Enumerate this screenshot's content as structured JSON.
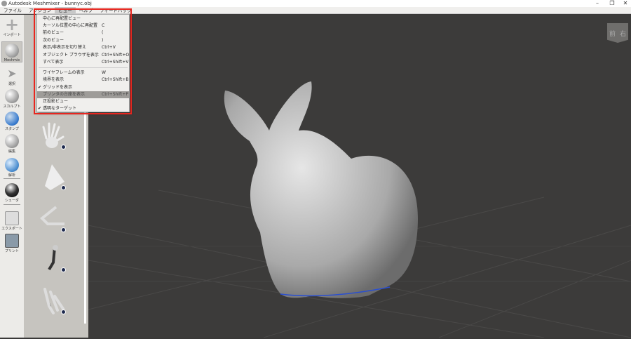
{
  "window": {
    "title": "Autodesk Meshmixer - bunnyc.obj",
    "minimize": "–",
    "restore": "❐",
    "close": "✕"
  },
  "menubar": [
    "ファイル",
    "アクション",
    "ビュー",
    "ヘルプ",
    "フィードバック"
  ],
  "view_menu": {
    "items": [
      {
        "label": "中心に再配置ビュー",
        "shortcut": "",
        "checked": false
      },
      {
        "label": "カーソル位置の中心に再配置",
        "shortcut": "C",
        "checked": false
      },
      {
        "label": "前のビュー",
        "shortcut": "(",
        "checked": false
      },
      {
        "label": "次のビュー",
        "shortcut": ")",
        "checked": false
      },
      {
        "label": "表示/非表示を切り替え",
        "shortcut": "Ctrl+V",
        "checked": false
      },
      {
        "label": "オブジェクト ブラウザを表示",
        "shortcut": "Ctrl+Shift+O",
        "checked": false
      },
      {
        "label": "すべて表示",
        "shortcut": "Ctrl+Shift+V",
        "checked": false
      },
      {
        "label": "ワイヤフレームの表示",
        "shortcut": "W",
        "checked": false
      },
      {
        "label": "境界を表示",
        "shortcut": "Ctrl+Shift+B",
        "checked": false
      },
      {
        "label": "グリッドを表示",
        "shortcut": "",
        "checked": true
      },
      {
        "label": "プリンタの台座を表示",
        "shortcut": "Ctrl+Shift+P",
        "checked": false,
        "highlighted": true
      },
      {
        "label": "正投影ビュー",
        "shortcut": "",
        "checked": false
      },
      {
        "label": "透明なターゲット",
        "shortcut": "",
        "checked": true
      }
    ],
    "check": "✔"
  },
  "tools": [
    "インポート",
    "Meshmix",
    "選択",
    "スカルプト",
    "スタンプ",
    "編集",
    "解析",
    "シェーダ",
    "エクスポート",
    "プリント"
  ],
  "viewcube": {
    "front": "前",
    "right": "右"
  },
  "colors": {
    "highlight_box": "#e8261f",
    "viewport": "#3c3b3a"
  }
}
